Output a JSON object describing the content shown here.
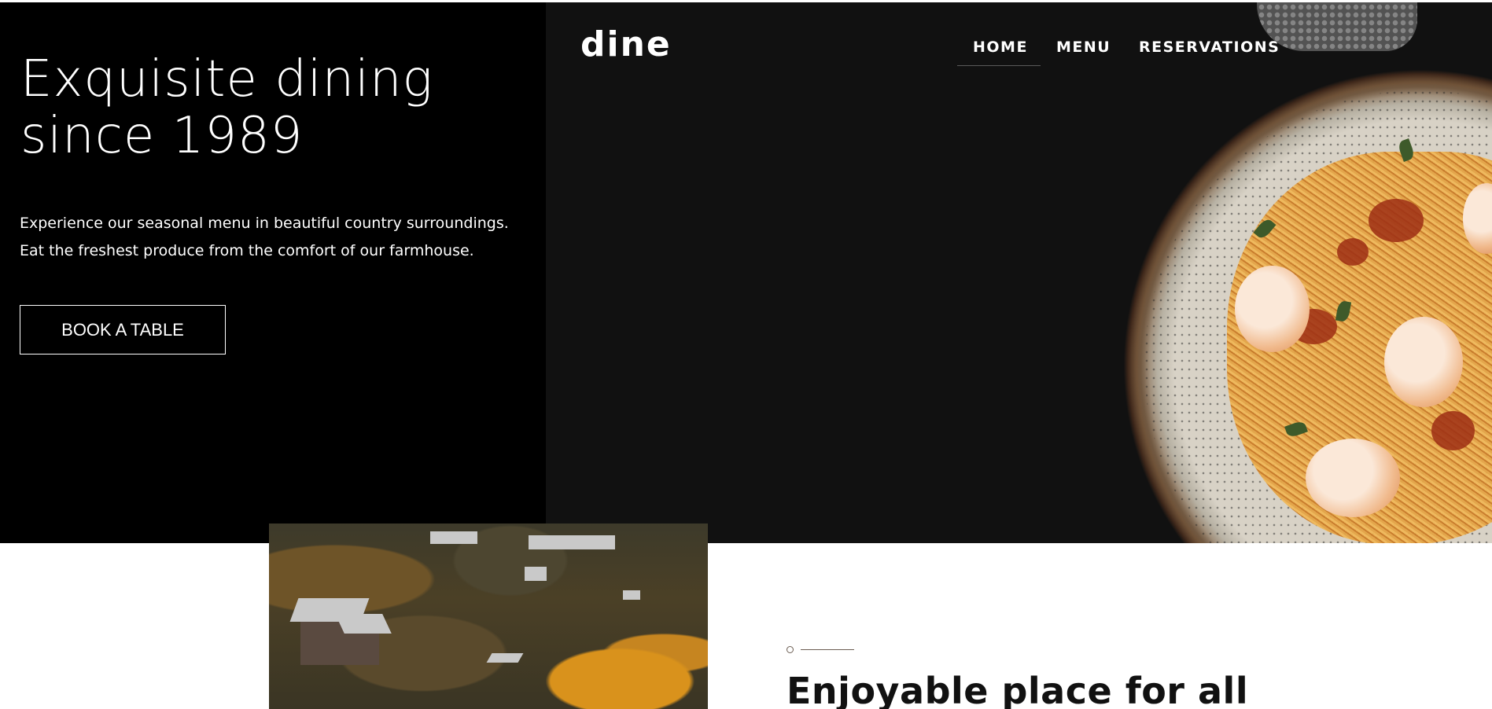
{
  "hero": {
    "title_line1": "Exquisite dining",
    "title_line2": "since 1989",
    "text_line1": "Experience our seasonal menu in beautiful country surroundings.",
    "text_line2": "Eat the freshest produce from the comfort of our farmhouse.",
    "book_label": "BOOK A TABLE"
  },
  "header": {
    "logo": "dine",
    "nav": [
      {
        "label": "HOME"
      },
      {
        "label": "MENU"
      },
      {
        "label": "RESERVATIONS"
      }
    ],
    "active": "HOME"
  },
  "section": {
    "title": "Enjoyable place for all"
  },
  "colors": {
    "hero_left_bg": "#000000",
    "hero_right_bg": "#111111",
    "text_light": "#ffffff",
    "text_dark": "#111111",
    "accent_line": "#6b5d52"
  }
}
